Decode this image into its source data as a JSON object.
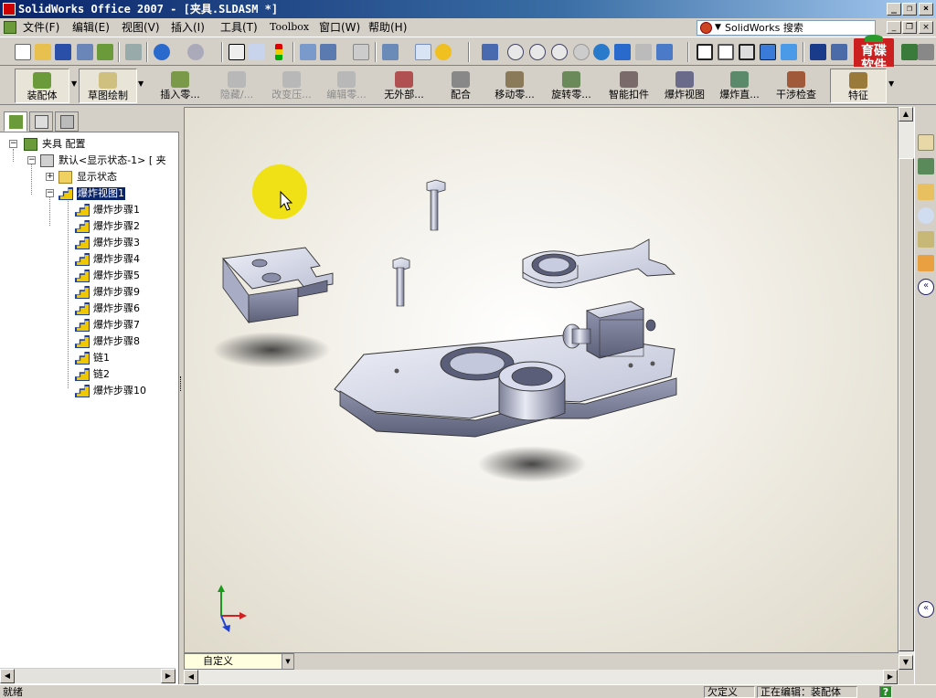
{
  "window": {
    "title": "SolidWorks Office 2007 - [夹具.SLDASM *]"
  },
  "menu": {
    "items": [
      "文件(F)",
      "编辑(E)",
      "视图(V)",
      "插入(I)",
      "工具(T)",
      "Toolbox",
      "窗口(W)",
      "帮助(H)"
    ]
  },
  "search": {
    "label": "SolidWorks 搜索"
  },
  "logo": {
    "line1": "育碟",
    "line2": "软件"
  },
  "commands": [
    {
      "label": "装配体",
      "enabled": true
    },
    {
      "label": "草图绘制",
      "enabled": true
    },
    {
      "label": "插入零...",
      "enabled": true
    },
    {
      "label": "隐藏/...",
      "enabled": false
    },
    {
      "label": "改变压...",
      "enabled": false
    },
    {
      "label": "编辑零...",
      "enabled": false
    },
    {
      "label": "无外部...",
      "enabled": true
    },
    {
      "label": "配合",
      "enabled": true
    },
    {
      "label": "移动零...",
      "enabled": true
    },
    {
      "label": "旋转零...",
      "enabled": true
    },
    {
      "label": "智能扣件",
      "enabled": true
    },
    {
      "label": "爆炸视图",
      "enabled": true
    },
    {
      "label": "爆炸直...",
      "enabled": true
    },
    {
      "label": "干涉检查",
      "enabled": true
    },
    {
      "label": "特征",
      "enabled": true
    }
  ],
  "tree": {
    "root": "夹具 配置",
    "config": "默认<显示状态-1> [ 夹",
    "display_states": "显示状态",
    "explode_view": "爆炸视图1",
    "steps": [
      "爆炸步骤1",
      "爆炸步骤2",
      "爆炸步骤3",
      "爆炸步骤4",
      "爆炸步骤5",
      "爆炸步骤9",
      "爆炸步骤6",
      "爆炸步骤7",
      "爆炸步骤8",
      "链1",
      "链2",
      "爆炸步骤10"
    ]
  },
  "view": {
    "orientation": "自定义"
  },
  "status": {
    "left": "就绪",
    "mode": "欠定义",
    "editing": "正在编辑：装配体",
    "help": "?"
  },
  "colors": {
    "title_start": "#0a246a",
    "highlight": "#0a246a",
    "accent_yellow": "#f0e000"
  }
}
